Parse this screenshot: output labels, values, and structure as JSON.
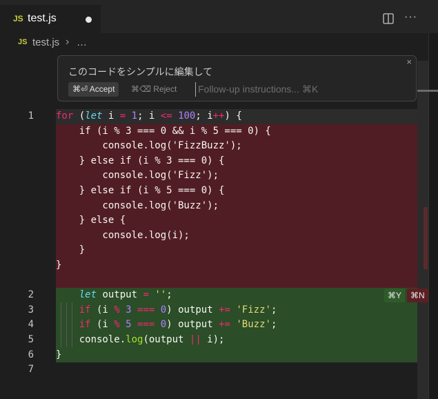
{
  "tab": {
    "badge": "JS",
    "title": "test.js"
  },
  "breadcrumb": {
    "badge": "JS",
    "file": "test.js",
    "separator": "›",
    "ellipsis": "…"
  },
  "inline_chat": {
    "prompt": "このコードをシンプルに編集して",
    "accept_label": "⌘⏎ Accept",
    "reject_label": "⌘⌫ Reject",
    "input_placeholder": "Follow-up instructions... ⌘K",
    "close": "×"
  },
  "hunk_actions": {
    "accept": "⌘Y",
    "reject": "⌘N"
  },
  "toolbar": {
    "more": "···"
  },
  "gutter": [
    "1",
    "2",
    "3",
    "4",
    "5",
    "6",
    "7"
  ],
  "colors": {
    "deleted_bg": "#511d24",
    "added_bg": "#2b4d28",
    "editor_bg": "#1e1e1e"
  }
}
